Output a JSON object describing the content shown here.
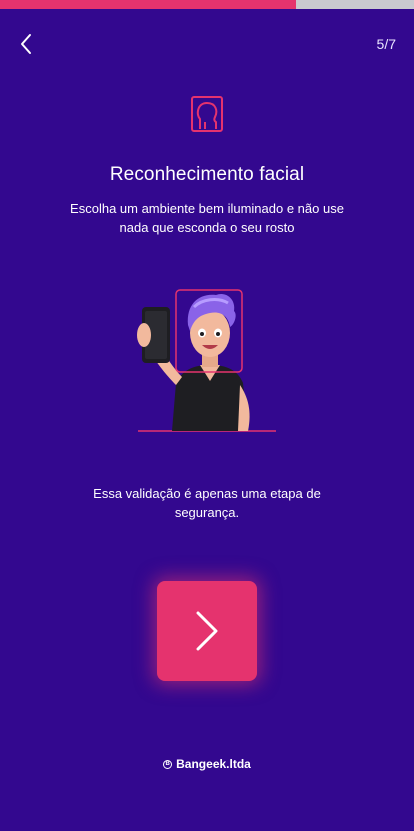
{
  "progress": {
    "current_step": 5,
    "total_steps": 7,
    "fill_color": "#e5336e",
    "track_color": "#c9c9cf",
    "fill_fraction": 0.714
  },
  "header": {
    "back_icon": "chevron-left-icon",
    "step_label": "5/7"
  },
  "content": {
    "icon": "face-recognition-icon",
    "title": "Reconhecimento facial",
    "subtitle": "Escolha um ambiente bem iluminado e não use nada que esconda o seu rosto",
    "illustration": "selfie-person-illustration",
    "info_text": "Essa validação é apenas uma etapa de segurança."
  },
  "actions": {
    "next_icon": "chevron-right-icon",
    "accent_color": "#e5336e"
  },
  "footer": {
    "brand_icon": "brand-logo-icon",
    "brand_name": "Bangeek.ltda"
  },
  "colors": {
    "background": "#33088f",
    "accent": "#e5336e"
  }
}
